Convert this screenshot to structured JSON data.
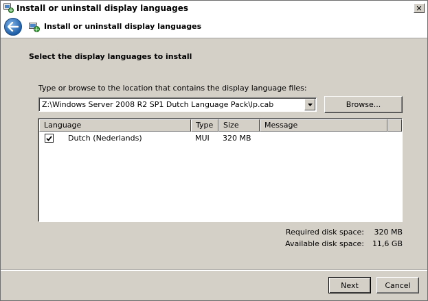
{
  "window": {
    "title": "Install or uninstall display languages"
  },
  "titlebar": {
    "close_glyph": "✕"
  },
  "header": {
    "title": "Install or uninstall display languages",
    "back_icon": "back-arrow-icon"
  },
  "section": {
    "title": "Select the display languages to install",
    "path_label": "Type or browse to the location that contains the display language files:",
    "path_value": "Z:\\Windows Server 2008 R2 SP1 Dutch Language Pack\\lp.cab",
    "browse_label": "Browse..."
  },
  "table": {
    "columns": [
      "Language",
      "Type",
      "Size",
      "Message"
    ],
    "rows": [
      {
        "checked": true,
        "language": "Dutch (Nederlands)",
        "type": "MUI",
        "size": "320 MB",
        "message": ""
      }
    ]
  },
  "disk": {
    "required_label": "Required disk space:",
    "required_value": "320 MB",
    "available_label": "Available disk space:",
    "available_value": "11,6 GB"
  },
  "footer": {
    "next_label": "Next",
    "cancel_label": "Cancel"
  }
}
